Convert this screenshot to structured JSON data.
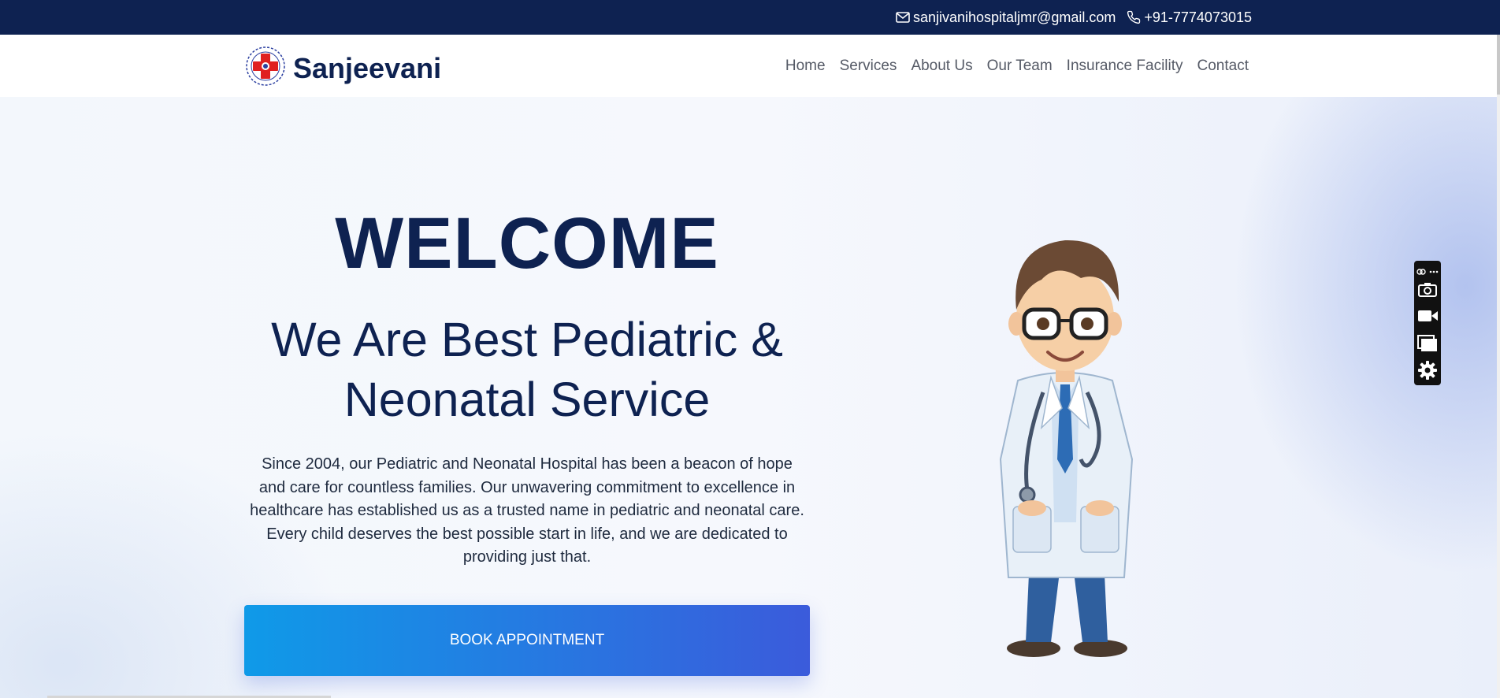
{
  "topbar": {
    "email": "sanjivanihospitaljmr@gmail.com",
    "phone": "+91-7774073015",
    "bg_color": "#0e2251",
    "icons": [
      "mail-icon",
      "phone-icon"
    ]
  },
  "brand": {
    "name": "Sanjeevani",
    "logo_icon": "hospital-cross-logo"
  },
  "nav": {
    "items": [
      "Home",
      "Services",
      "About Us",
      "Our Team",
      "Insurance Facility",
      "Contact"
    ]
  },
  "hero": {
    "welcome": "WELCOME",
    "headline_line1": "We Are Best Pediatric &",
    "headline_line2": "Neonatal Service",
    "description_lines": [
      "Since 2004, our Pediatric and Neonatal Hospital has been a beacon of hope",
      "and care for countless families. Our unwavering commitment to excellence in",
      "healthcare has established us as a trusted name in pediatric and neonatal care.",
      "Every child deserves the best possible start in life, and we are dedicated to",
      "providing just that."
    ],
    "cta_label": "BOOK APPOINTMENT",
    "illustration": "cartoon-doctor-illustration",
    "colors": {
      "heading": "#0e2251",
      "cta_start": "#0f9ae8",
      "cta_end": "#3b5bdb"
    }
  },
  "floating_toolbar": {
    "icons": [
      "link-icon",
      "more-icon",
      "camera-icon",
      "video-icon",
      "windows-icon",
      "gear-icon"
    ]
  }
}
